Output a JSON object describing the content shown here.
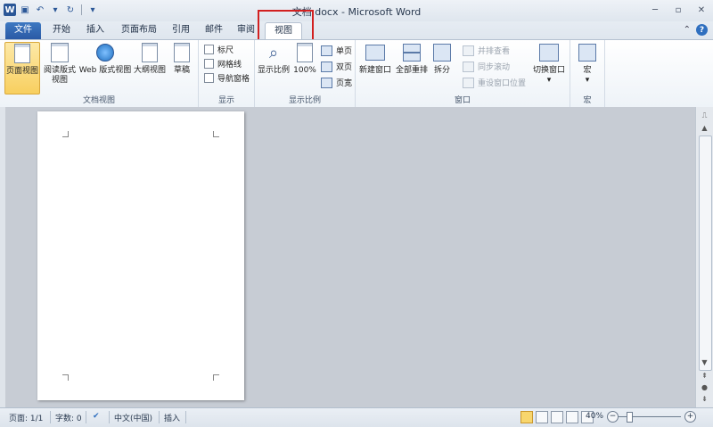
{
  "window": {
    "title": "文档.docx - Microsoft Word"
  },
  "quick_access": {
    "app_icon": "W"
  },
  "tabs": [
    {
      "label": "文件"
    },
    {
      "label": "开始"
    },
    {
      "label": "插入"
    },
    {
      "label": "页面布局"
    },
    {
      "label": "引用"
    },
    {
      "label": "邮件"
    },
    {
      "label": "审阅"
    },
    {
      "label": "视图"
    }
  ],
  "ribbon": {
    "document_views": {
      "group_label": "文档视图",
      "buttons": [
        "页面视图",
        "阅读版式",
        "视图",
        "Web 版式视图",
        "大纲视图",
        "草稿"
      ]
    },
    "show": {
      "group_label": "显示",
      "checkboxes": [
        "标尺",
        "网格线",
        "导航窗格"
      ]
    },
    "zoom": {
      "group_label": "显示比例",
      "zoom_label": "显示比例",
      "percent_label": "100%",
      "small": [
        "单页",
        "双页",
        "页宽"
      ]
    },
    "window": {
      "group_label": "窗口",
      "new_window": "新建窗口",
      "arrange_all": "全部重排",
      "split": "拆分",
      "side_by_side": "并排查看",
      "sync_scroll": "同步滚动",
      "reset_position": "重设窗口位置",
      "switch_windows": "切换窗口"
    },
    "macros": {
      "group_label": "宏",
      "label": "宏"
    }
  },
  "status": {
    "page": "页面: 1/1",
    "words": "字数: 0",
    "language": "中文(中国)",
    "mode": "插入",
    "zoom": "40%"
  }
}
